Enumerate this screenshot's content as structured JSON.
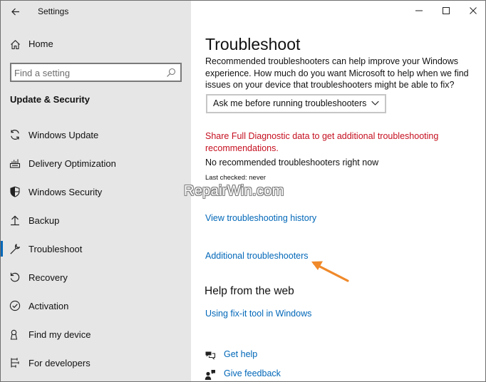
{
  "window": {
    "title": "Settings",
    "controls": [
      "minimize",
      "maximize",
      "close"
    ]
  },
  "sidebar": {
    "home_label": "Home",
    "search": {
      "placeholder": "Find a setting",
      "value": ""
    },
    "section_heading": "Update & Security",
    "items": [
      {
        "label": "Windows Update",
        "icon": "refresh-icon",
        "active": false
      },
      {
        "label": "Delivery Optimization",
        "icon": "delivery-icon",
        "active": false
      },
      {
        "label": "Windows Security",
        "icon": "shield-icon",
        "active": false
      },
      {
        "label": "Backup",
        "icon": "backup-icon",
        "active": false
      },
      {
        "label": "Troubleshoot",
        "icon": "wrench-icon",
        "active": true
      },
      {
        "label": "Recovery",
        "icon": "recovery-icon",
        "active": false
      },
      {
        "label": "Activation",
        "icon": "check-circle-icon",
        "active": false
      },
      {
        "label": "Find my device",
        "icon": "find-device-icon",
        "active": false
      },
      {
        "label": "For developers",
        "icon": "developer-icon",
        "active": false
      }
    ]
  },
  "main": {
    "title": "Troubleshoot",
    "intro": "Recommended troubleshooters can help improve your Windows experience. How much do you want Microsoft to help when we find issues on your device that troubleshooters might be able to fix?",
    "dropdown_value": "Ask me before running troubleshooters",
    "diagnostic_link": "Share Full Diagnostic data to get additional troubleshooting recommendations.",
    "no_recommended": "No recommended troubleshooters right now",
    "last_checked": "Last checked: never",
    "watermark": "RepairWin.com",
    "history_link": "View troubleshooting history",
    "additional_link": "Additional troubleshooters",
    "help_heading": "Help from the web",
    "fixit_link": "Using fix-it tool in Windows",
    "get_help": "Get help",
    "give_feedback": "Give feedback"
  },
  "colors": {
    "accent": "#0067b8",
    "warning_link": "#c50f1f",
    "sidebar_bg": "#e6e6e6",
    "annotation_arrow": "#f0892a"
  }
}
